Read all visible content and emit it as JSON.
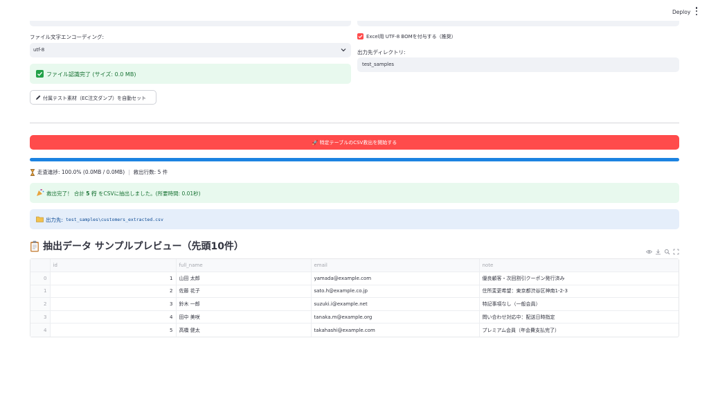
{
  "header": {
    "deploy_label": "Deploy"
  },
  "left": {
    "encoding_label": "ファイル文字エンコーディング:",
    "encoding_value": "utf-8",
    "recognized_message": "ファイル認識完了 (サイズ: 0.0 MB)",
    "autoset_button": "付属テスト素材（EC注文ダンプ）を自動セット"
  },
  "right": {
    "bom_checkbox_label": "Excel用 UTF-8 BOMを付与する（推奨）",
    "bom_checked": true,
    "output_dir_label": "出力先ディレクトリ:",
    "output_dir_value": "test_samples"
  },
  "run_button": "🚀 特定テーブルのCSV救出を開始する",
  "progress": {
    "fraction": 1.0,
    "color": "#1c83e1"
  },
  "status": {
    "scan_progress": "走査進捗: 100.0% (0.0MB / 0.0MB)",
    "rescued_rows": "救出行数: 5 件"
  },
  "success": {
    "prefix": "救出完了！ 合計 ",
    "count": "5 行",
    "suffix": " をCSVに抽出しました。(所要時間: 0.01秒)"
  },
  "output": {
    "label": "出力先:",
    "path": "test_samples\\customers_extracted.csv"
  },
  "preview": {
    "title": "抽出データ サンプルプレビュー（先頭10件）",
    "columns": [
      "",
      "id",
      "full_name",
      "email",
      "note"
    ],
    "rows": [
      [
        "0",
        "1",
        "山田 太郎",
        "yamada@example.com",
        "優良顧客・次回割引クーポン発行済み"
      ],
      [
        "1",
        "2",
        "佐藤 花子",
        "sato.h@example.co.jp",
        "住所変更希望：東京都渋谷区神南1-2-3"
      ],
      [
        "2",
        "3",
        "鈴木 一郎",
        "suzuki.i@example.net",
        "特記事項なし（一般会員）"
      ],
      [
        "3",
        "4",
        "田中 美咲",
        "tanaka.m@example.org",
        "問い合わせ対応中：配送日時指定"
      ],
      [
        "4",
        "5",
        "高橋 健太",
        "takahashi@example.com",
        "プレミアム会員（年会費支払完了）"
      ]
    ]
  },
  "colors": {
    "primary": "#ff4b4b",
    "success_bg": "#e8f9ee",
    "info_bg": "#e5eefa"
  }
}
